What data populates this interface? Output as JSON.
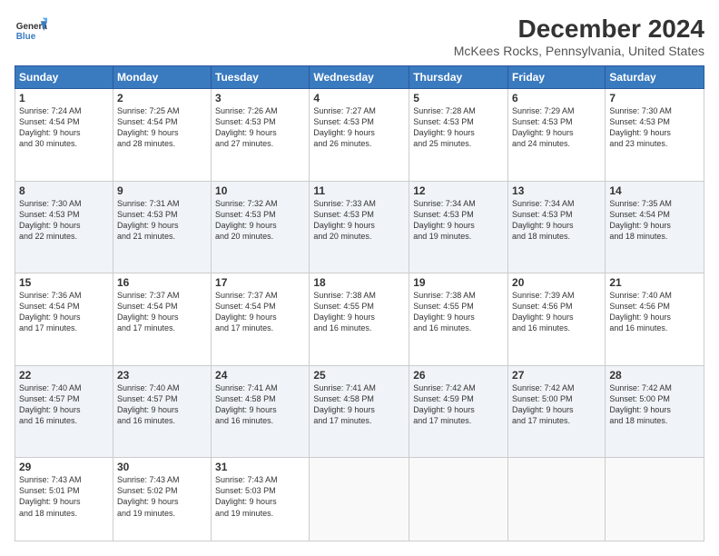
{
  "header": {
    "logo_line1": "General",
    "logo_line2": "Blue",
    "main_title": "December 2024",
    "subtitle": "McKees Rocks, Pennsylvania, United States"
  },
  "columns": [
    "Sunday",
    "Monday",
    "Tuesday",
    "Wednesday",
    "Thursday",
    "Friday",
    "Saturday"
  ],
  "weeks": [
    [
      {
        "day": "1",
        "info": "Sunrise: 7:24 AM\nSunset: 4:54 PM\nDaylight: 9 hours\nand 30 minutes."
      },
      {
        "day": "2",
        "info": "Sunrise: 7:25 AM\nSunset: 4:54 PM\nDaylight: 9 hours\nand 28 minutes."
      },
      {
        "day": "3",
        "info": "Sunrise: 7:26 AM\nSunset: 4:53 PM\nDaylight: 9 hours\nand 27 minutes."
      },
      {
        "day": "4",
        "info": "Sunrise: 7:27 AM\nSunset: 4:53 PM\nDaylight: 9 hours\nand 26 minutes."
      },
      {
        "day": "5",
        "info": "Sunrise: 7:28 AM\nSunset: 4:53 PM\nDaylight: 9 hours\nand 25 minutes."
      },
      {
        "day": "6",
        "info": "Sunrise: 7:29 AM\nSunset: 4:53 PM\nDaylight: 9 hours\nand 24 minutes."
      },
      {
        "day": "7",
        "info": "Sunrise: 7:30 AM\nSunset: 4:53 PM\nDaylight: 9 hours\nand 23 minutes."
      }
    ],
    [
      {
        "day": "8",
        "info": "Sunrise: 7:30 AM\nSunset: 4:53 PM\nDaylight: 9 hours\nand 22 minutes."
      },
      {
        "day": "9",
        "info": "Sunrise: 7:31 AM\nSunset: 4:53 PM\nDaylight: 9 hours\nand 21 minutes."
      },
      {
        "day": "10",
        "info": "Sunrise: 7:32 AM\nSunset: 4:53 PM\nDaylight: 9 hours\nand 20 minutes."
      },
      {
        "day": "11",
        "info": "Sunrise: 7:33 AM\nSunset: 4:53 PM\nDaylight: 9 hours\nand 20 minutes."
      },
      {
        "day": "12",
        "info": "Sunrise: 7:34 AM\nSunset: 4:53 PM\nDaylight: 9 hours\nand 19 minutes."
      },
      {
        "day": "13",
        "info": "Sunrise: 7:34 AM\nSunset: 4:53 PM\nDaylight: 9 hours\nand 18 minutes."
      },
      {
        "day": "14",
        "info": "Sunrise: 7:35 AM\nSunset: 4:54 PM\nDaylight: 9 hours\nand 18 minutes."
      }
    ],
    [
      {
        "day": "15",
        "info": "Sunrise: 7:36 AM\nSunset: 4:54 PM\nDaylight: 9 hours\nand 17 minutes."
      },
      {
        "day": "16",
        "info": "Sunrise: 7:37 AM\nSunset: 4:54 PM\nDaylight: 9 hours\nand 17 minutes."
      },
      {
        "day": "17",
        "info": "Sunrise: 7:37 AM\nSunset: 4:54 PM\nDaylight: 9 hours\nand 17 minutes."
      },
      {
        "day": "18",
        "info": "Sunrise: 7:38 AM\nSunset: 4:55 PM\nDaylight: 9 hours\nand 16 minutes."
      },
      {
        "day": "19",
        "info": "Sunrise: 7:38 AM\nSunset: 4:55 PM\nDaylight: 9 hours\nand 16 minutes."
      },
      {
        "day": "20",
        "info": "Sunrise: 7:39 AM\nSunset: 4:56 PM\nDaylight: 9 hours\nand 16 minutes."
      },
      {
        "day": "21",
        "info": "Sunrise: 7:40 AM\nSunset: 4:56 PM\nDaylight: 9 hours\nand 16 minutes."
      }
    ],
    [
      {
        "day": "22",
        "info": "Sunrise: 7:40 AM\nSunset: 4:57 PM\nDaylight: 9 hours\nand 16 minutes."
      },
      {
        "day": "23",
        "info": "Sunrise: 7:40 AM\nSunset: 4:57 PM\nDaylight: 9 hours\nand 16 minutes."
      },
      {
        "day": "24",
        "info": "Sunrise: 7:41 AM\nSunset: 4:58 PM\nDaylight: 9 hours\nand 16 minutes."
      },
      {
        "day": "25",
        "info": "Sunrise: 7:41 AM\nSunset: 4:58 PM\nDaylight: 9 hours\nand 17 minutes."
      },
      {
        "day": "26",
        "info": "Sunrise: 7:42 AM\nSunset: 4:59 PM\nDaylight: 9 hours\nand 17 minutes."
      },
      {
        "day": "27",
        "info": "Sunrise: 7:42 AM\nSunset: 5:00 PM\nDaylight: 9 hours\nand 17 minutes."
      },
      {
        "day": "28",
        "info": "Sunrise: 7:42 AM\nSunset: 5:00 PM\nDaylight: 9 hours\nand 18 minutes."
      }
    ],
    [
      {
        "day": "29",
        "info": "Sunrise: 7:43 AM\nSunset: 5:01 PM\nDaylight: 9 hours\nand 18 minutes."
      },
      {
        "day": "30",
        "info": "Sunrise: 7:43 AM\nSunset: 5:02 PM\nDaylight: 9 hours\nand 19 minutes."
      },
      {
        "day": "31",
        "info": "Sunrise: 7:43 AM\nSunset: 5:03 PM\nDaylight: 9 hours\nand 19 minutes."
      },
      null,
      null,
      null,
      null
    ]
  ]
}
